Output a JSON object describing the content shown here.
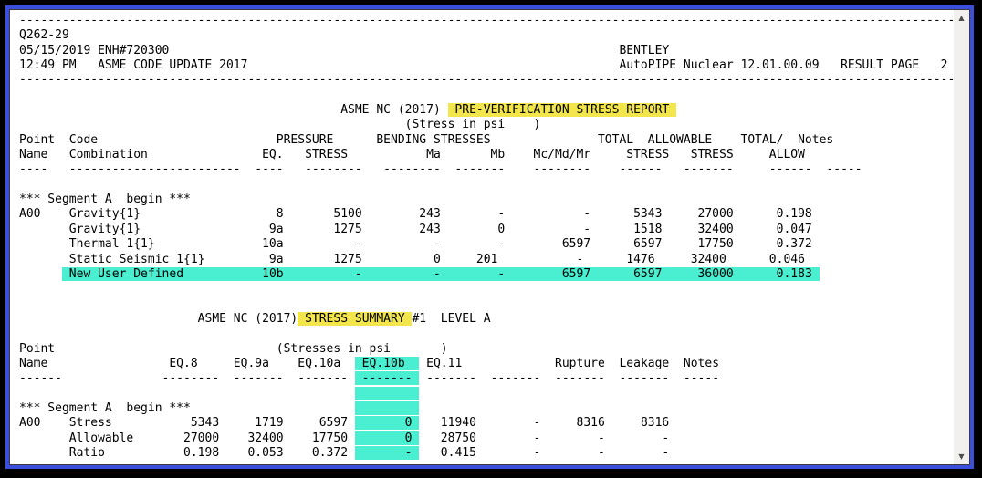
{
  "colors": {
    "highlight_yellow": "#F3E64C",
    "highlight_cyan": "#49EFD0",
    "window_border_blue": "#3B4FDC"
  },
  "scrollbar": {
    "up_glyph": "▲",
    "down_glyph": "▼"
  },
  "report": {
    "lines": [
      [
        {
          "t": "-----------------------------------------------------------------------------------------------------------------------------------"
        }
      ],
      [
        {
          "t": "Q262-29"
        }
      ],
      [
        {
          "t": "05/15/2019 ENH#720300                                                               BENTLEY"
        }
      ],
      [
        {
          "t": "12:49 PM   ASME CODE UPDATE 2017                                                    AutoPIPE Nuclear 12.01.00.09   RESULT PAGE   2"
        }
      ],
      [
        {
          "t": "-----------------------------------------------------------------------------------------------------------------------------------"
        }
      ],
      [
        {
          "t": ""
        }
      ],
      [
        {
          "t": "                                             ASME NC (2017) "
        },
        {
          "t": " PRE-VERIFICATION STRESS REPORT ",
          "h": "y"
        }
      ],
      [
        {
          "t": "                                                      (Stress in psi    )"
        }
      ],
      [
        {
          "t": "Point  Code                         PRESSURE      BENDING STRESSES               TOTAL  ALLOWABLE    TOTAL/  Notes"
        }
      ],
      [
        {
          "t": "Name   Combination                EQ.   STRESS           Ma       Mb    Mc/Md/Mr     STRESS   STRESS     ALLOW"
        }
      ],
      [
        {
          "t": "----   ------------------------  ----   --------   --------  -------    --------    ------   -------     ------  -----"
        }
      ],
      [
        {
          "t": ""
        }
      ],
      [
        {
          "t": "*** Segment A  begin ***"
        }
      ],
      [
        {
          "t": "A00    Gravity{1}                   8       5100        243        -           -      5343     27000      0.198"
        }
      ],
      [
        {
          "t": "       Gravity{1}                  9a       1275        243        0           -      1518     32400      0.047"
        }
      ],
      [
        {
          "t": "       Thermal 1{1}               10a          -          -        -        6597      6597     17750      0.372"
        }
      ],
      [
        {
          "t": "       Static Seismic 1{1}         9a       1275          0     201           -      1476     32400      0.046"
        }
      ],
      [
        {
          "t": "      "
        },
        {
          "t": " New User Defined           10b          -          -        -        6597      6597     36000      0.183 ",
          "h": "c"
        }
      ],
      [
        {
          "t": ""
        }
      ],
      [
        {
          "t": ""
        }
      ],
      [
        {
          "t": "                         ASME NC (2017)"
        },
        {
          "t": " STRESS SUMMARY ",
          "h": "y"
        },
        {
          "t": "#1  LEVEL A"
        }
      ],
      [
        {
          "t": ""
        }
      ],
      [
        {
          "t": "Point                               (Stresses in psi       )"
        }
      ],
      [
        {
          "t": "Name                 EQ.8     EQ.9a    EQ.10a  "
        },
        {
          "t": " EQ.10b  ",
          "h": "c"
        },
        {
          "t": " EQ.11             Rupture  Leakage  Notes"
        }
      ],
      [
        {
          "t": "------              --------  -------  ------- "
        },
        {
          "t": " ------- ",
          "h": "c"
        },
        {
          "t": " -------  -------  -------  -------  -----"
        }
      ],
      [
        {
          "t": "                                               "
        },
        {
          "t": "         ",
          "h": "c"
        }
      ],
      [
        {
          "t": "*** Segment A  begin ***                       "
        },
        {
          "t": "         ",
          "h": "c"
        }
      ],
      [
        {
          "t": "A00    Stress           5343     1719     6597 "
        },
        {
          "t": "       0 ",
          "h": "c"
        },
        {
          "t": "   11940        -     8316     8316"
        }
      ],
      [
        {
          "t": "       Allowable       27000    32400    17750 "
        },
        {
          "t": "       0 ",
          "h": "c"
        },
        {
          "t": "   28750        -        -        -"
        }
      ],
      [
        {
          "t": "       Ratio           0.198    0.053    0.372 "
        },
        {
          "t": "       - ",
          "h": "c"
        },
        {
          "t": "   0.415        -        -        -"
        }
      ]
    ]
  }
}
